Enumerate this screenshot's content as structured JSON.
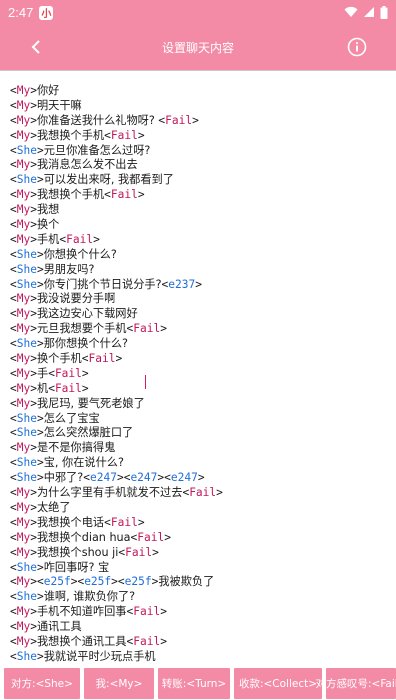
{
  "status_bar": {
    "time": "2:47",
    "notif_badge": "小"
  },
  "app_bar": {
    "title": "设置聊天内容"
  },
  "editor": {
    "lines": [
      [
        {
          "t": "My"
        },
        {
          "x": "你好"
        }
      ],
      [
        {
          "t": "My"
        },
        {
          "x": "明天干嘛"
        }
      ],
      [
        {
          "t": "My"
        },
        {
          "x": "你准备送我什么礼物呀? "
        },
        {
          "t": "Fail"
        }
      ],
      [
        {
          "t": "My"
        },
        {
          "x": "我想换个手机"
        },
        {
          "t": "Fail"
        }
      ],
      [
        {
          "t": "She"
        },
        {
          "x": "元旦你准备怎么过呀?"
        }
      ],
      [
        {
          "t": "My"
        },
        {
          "x": "我消息怎么发不出去"
        }
      ],
      [
        {
          "t": "She"
        },
        {
          "x": "可以发出来呀, 我都看到了"
        }
      ],
      [
        {
          "t": "My"
        },
        {
          "x": "我想换个手机"
        },
        {
          "t": "Fail"
        }
      ],
      [
        {
          "t": "My"
        },
        {
          "x": "我想"
        }
      ],
      [
        {
          "t": "My"
        },
        {
          "x": "换个"
        }
      ],
      [
        {
          "t": "My"
        },
        {
          "x": "手机"
        },
        {
          "t": "Fail"
        }
      ],
      [
        {
          "t": "She"
        },
        {
          "x": "你想换个什么?"
        }
      ],
      [
        {
          "t": "She"
        },
        {
          "x": "男朋友吗?"
        }
      ],
      [
        {
          "t": "She"
        },
        {
          "x": "你专门挑个节日说分手?"
        },
        {
          "t": "e237"
        }
      ],
      [
        {
          "t": "My"
        },
        {
          "x": "我没说要分手啊"
        }
      ],
      [
        {
          "t": "My"
        },
        {
          "x": "我这边安心下载网好"
        }
      ],
      [
        {
          "t": "My"
        },
        {
          "x": "元旦我想要个手机"
        },
        {
          "t": "Fail"
        }
      ],
      [
        {
          "t": "She"
        },
        {
          "x": "那你想换个什么?"
        }
      ],
      [
        {
          "t": "My"
        },
        {
          "x": "换个手机"
        },
        {
          "t": "Fail"
        }
      ],
      [
        {
          "t": "My"
        },
        {
          "x": "手"
        },
        {
          "t": "Fail"
        }
      ],
      [
        {
          "t": "My"
        },
        {
          "x": "机"
        },
        {
          "t": "Fail"
        }
      ],
      [
        {
          "t": "My"
        },
        {
          "x": "我尼玛, 要气死老娘了"
        }
      ],
      [
        {
          "t": "She"
        },
        {
          "x": "怎么了宝宝"
        }
      ],
      [
        {
          "t": "She"
        },
        {
          "x": "怎么突然爆脏口了"
        }
      ],
      [
        {
          "t": "My"
        },
        {
          "x": "是不是你搞得鬼"
        }
      ],
      [
        {
          "t": "She"
        },
        {
          "x": "宝, 你在说什么?"
        }
      ],
      [
        {
          "t": "She"
        },
        {
          "x": "中邪了?"
        },
        {
          "t": "e247"
        },
        {
          "t": "e247"
        },
        {
          "t": "e247"
        }
      ],
      [
        {
          "t": "My"
        },
        {
          "x": "为什么字里有手机就发不过去"
        },
        {
          "t": "Fail"
        }
      ],
      [
        {
          "t": "My"
        },
        {
          "x": "太绝了"
        }
      ],
      [
        {
          "t": "My"
        },
        {
          "x": "我想换个电话"
        },
        {
          "t": "Fail"
        }
      ],
      [
        {
          "t": "My"
        },
        {
          "x": "我想换个dian hua"
        },
        {
          "t": "Fail"
        }
      ],
      [
        {
          "t": "My"
        },
        {
          "x": "我想换个shou ji"
        },
        {
          "t": "Fail"
        }
      ],
      [
        {
          "t": "She"
        },
        {
          "x": "咋回事呀? 宝"
        }
      ],
      [
        {
          "t": "My"
        },
        {
          "t": "e25f"
        },
        {
          "t": "e25f"
        },
        {
          "t": "e25f"
        },
        {
          "x": "我被欺负了"
        }
      ],
      [
        {
          "t": "She"
        },
        {
          "x": "谁啊, 谁欺负你了?"
        }
      ],
      [
        {
          "t": "My"
        },
        {
          "x": "手机不知道咋回事"
        },
        {
          "t": "Fail"
        }
      ],
      [
        {
          "t": "My"
        },
        {
          "x": "通讯工具"
        }
      ],
      [
        {
          "t": "My"
        },
        {
          "x": "我想换个通讯工具"
        },
        {
          "t": "Fail"
        }
      ],
      [
        {
          "t": "She"
        },
        {
          "x": "我就说平时少玩点手机"
        }
      ]
    ]
  },
  "bottom_buttons": [
    {
      "label": "对方:<She>"
    },
    {
      "label": "我:<My>"
    },
    {
      "label": "转账:<Turn>"
    },
    {
      "label": "收款:<Collect>"
    },
    {
      "label": "对方感叹号:<Fail>"
    }
  ],
  "colors": {
    "accent": "#f48ba6",
    "tag_my": "#c2185b",
    "tag_she": "#1e6fd9"
  }
}
